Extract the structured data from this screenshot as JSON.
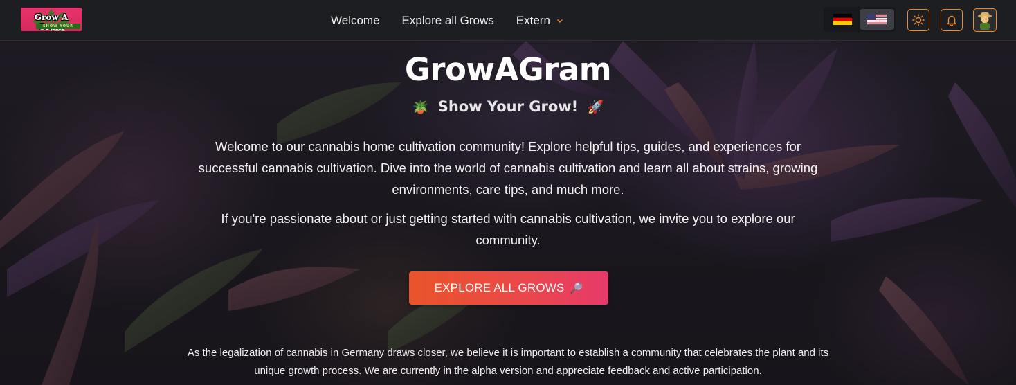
{
  "brand": {
    "logo_title": "Grow A Gram",
    "logo_tagline": "SHOW YOUR GROW"
  },
  "nav": {
    "links": [
      {
        "label": "Welcome"
      },
      {
        "label": "Explore all Grows"
      },
      {
        "label": "Extern",
        "has_dropdown": true
      }
    ]
  },
  "toolbar": {
    "languages": [
      {
        "code": "de",
        "icon": "german-flag-icon",
        "selected": false
      },
      {
        "code": "en",
        "icon": "us-flag-icon",
        "selected": true
      }
    ],
    "theme_icon": "sun-icon",
    "notifications_icon": "bell-icon",
    "avatar": "farmer-avatar"
  },
  "hero": {
    "title": "GrowAGram",
    "subtitle": "Show Your Grow!",
    "subtitle_emoji_left": "🪴",
    "subtitle_emoji_right": "🚀",
    "intro": "Welcome to our cannabis home cultivation community! Explore helpful tips, guides, and experiences for successful cannabis cultivation. Dive into the world of cannabis cultivation and learn all about strains, growing environments, care tips, and much more.",
    "invite": "If you're passionate about or just getting started with cannabis cultivation, we invite you to explore our community.",
    "cta_label": "EXPLORE ALL GROWS",
    "cta_emoji": "🔎",
    "footnote": "As the legalization of cannabis in Germany draws closer, we believe it is important to establish a community that celebrates the plant and its unique growth process. We are currently in the alpha version and appreciate feedback and active participation."
  },
  "colors": {
    "accent": "#f08a2c",
    "cta_start": "#e9542a",
    "cta_end": "#e63a6a",
    "navbar_bg": "#1c1e22"
  }
}
